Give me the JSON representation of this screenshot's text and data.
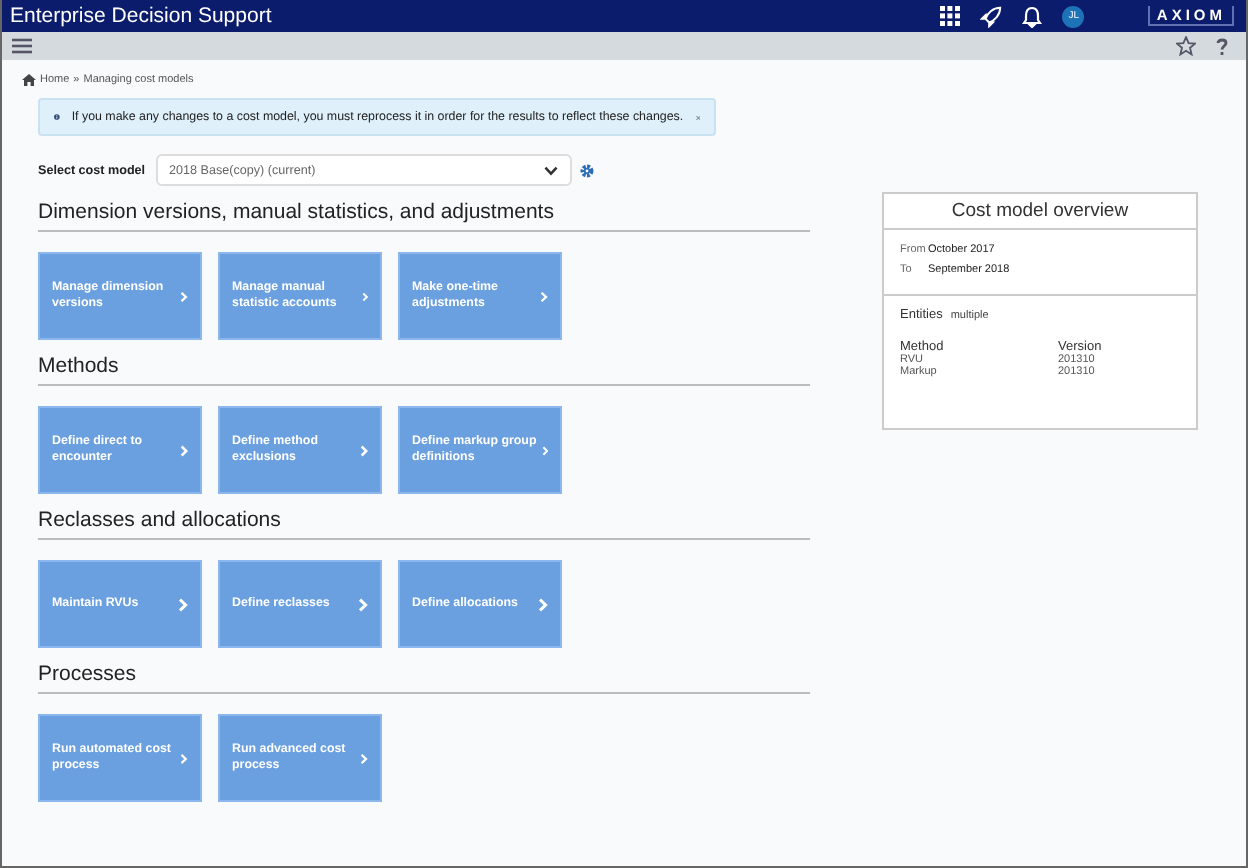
{
  "app_bar": {
    "title": "Enterprise Decision Support",
    "avatar": "JL",
    "logo": "AXIOM"
  },
  "breadcrumb": {
    "items": [
      "Home",
      "Managing cost models"
    ],
    "separator": "»"
  },
  "alert": {
    "message": "If you make any changes to a cost model, you must reprocess it in order for the results to reflect these changes."
  },
  "cost_model_select": {
    "label": "Select cost model",
    "value": "2018 Base(copy) (current)"
  },
  "sections": [
    {
      "heading": "Dimension versions, manual statistics, and adjustments",
      "tiles": [
        "Manage dimension versions",
        "Manage manual statistic accounts",
        "Make one-time adjustments"
      ]
    },
    {
      "heading": "Methods",
      "tiles": [
        "Define direct to encounter",
        "Define method exclusions",
        "Define markup group definitions"
      ]
    },
    {
      "heading": "Reclasses and allocations",
      "tiles": [
        "Maintain RVUs",
        "Define reclasses",
        "Define allocations"
      ]
    },
    {
      "heading": "Processes",
      "tiles": [
        "Run automated cost process",
        "Run advanced cost process"
      ]
    }
  ],
  "overview": {
    "title": "Cost model overview",
    "from_label": "From",
    "from": "October 2017",
    "to_label": "To",
    "to": "September 2018",
    "entities_label": "Entities",
    "entities": "multiple",
    "columns": [
      "Method",
      "Version"
    ],
    "rows": [
      [
        "RVU",
        "201310"
      ],
      [
        "Markup",
        "201310"
      ]
    ]
  }
}
